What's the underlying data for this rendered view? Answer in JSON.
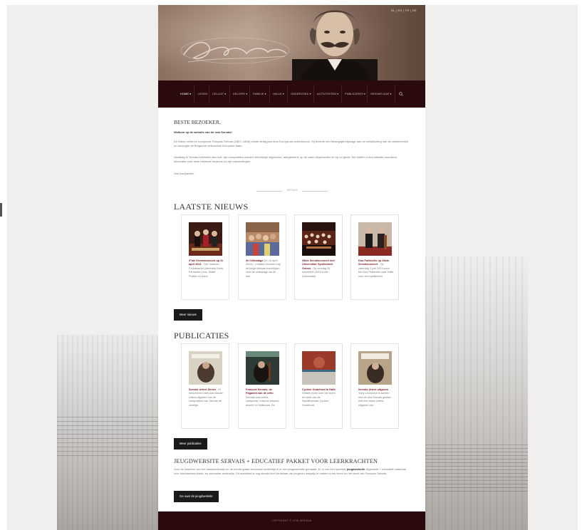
{
  "header": {
    "language_links": "NL  |  EN  |  FR  |  DE"
  },
  "nav": {
    "items": [
      {
        "label": "HOME ▾",
        "active": true
      },
      {
        "label": "LEVEN"
      },
      {
        "label": "CELLIST ▾"
      },
      {
        "label": "DELIVRE ▾"
      },
      {
        "label": "FAMILIE ▾"
      },
      {
        "label": "HALLE ▾"
      },
      {
        "label": "ONDERZOEK ▾"
      },
      {
        "label": "ACTIVITEITEN ▾"
      },
      {
        "label": "PUBLICATIES ▾"
      },
      {
        "label": "SERVAIS AGE ▾"
      }
    ],
    "search_icon": "search-icon"
  },
  "welcome": {
    "heading": "BESTE BEZOEKER,",
    "lead": "Welkom op de website van de vzw Servais!",
    "p1": "De Halse cellist en componist François Servais (1807–1866) reisde dertig jaar door Europa als cellovirtuoos. Hij leverde een belangrijke bijdrage aan de ontwikkeling van de cellotechniek en bezorgde de Belgische celloschool Europese faam.",
    "p2": "Vandaag is Servais bekender dan ooit: zijn composities worden wereldwijd uitgevoerd, aangekeerd, op de radio uitgezonden en op cd gezet. We bieden u een website boordevol informatie over deze bekende muzicus en zijn nakomelingen.",
    "p3": "Veel surfplezier!",
    "divider_text": "SERVAIS"
  },
  "news": {
    "title": "LAATSTE NIEUWS",
    "items": [
      {
        "title": "3°ste Servaisconcert op 11 april 2024",
        "text": " - Het Tarantan Cellokwartet (Mechiels Dolin, Fernando Lima, Didier Poskin en Karel"
      },
      {
        "title": "3e Cellostage",
        "text": " (11-14 april 2024) - Cellisten kunnen nog tot begin februari inschrijven voor de cellostage via de site."
      },
      {
        "title": "35ste Servaisconcert met Universitair Symfonisch Orkest",
        "text": " - Op zondag 26 november 2023 is het Universitair"
      },
      {
        "title": "Duo Potteceilo op 26ste Servaisconcert",
        "text": " - Op zaterdag 3 juni 2023 komt het Duo Potteceilo naar Halle voor een spetterend"
      }
    ],
    "button": "Meer nieuws"
  },
  "publications": {
    "title": "PUBLICATIES",
    "items": [
      {
        "title": "Servais Urtext Series",
        "text": " - Er verschenen heel wat nieuwe Urtext-uitgaven van de composities van Servais de voorbije"
      },
      {
        "title": "François Servais, de Paganini van de cello",
        "text": " - Servais was cellist, componist, reizend virtuoos, docent en Hallenaar. De"
      },
      {
        "title": "Cyclien Godefroid in Halle",
        "text": " - Ontdek meer over het leven en werk van de Ssedifroenaar Cyclien Godefroid."
      },
      {
        "title": "Servais Urtext uitgaven",
        "text": " - Yuny Leonovich is samen met de vzw Servais gestart met een reeks Urtext-uitgaven van"
      }
    ],
    "button": "Meer publicaties"
  },
  "youth": {
    "title": "JEUGDWEBSITE SERVAIS + EDUCATIEF PAKKET VOOR LEERKRACHTEN",
    "text_before": "Voor de kinderen van het basisonderwijs en de eerste graad secundair onderwijs is er een jeugdwebsite gemaakt. Er is ook een speciale ",
    "text_bold": "jeugdwebsite",
    "text_after": " uitgewerkt + educatief materiaal voor leerkrachten basis- en secundair onderwijs. Dit materiaal is nog steeds heel bruikbaar om jongeren wegwijs te maken in het leven en het werk van François Servais.",
    "button": "Ga naar de jeugdwebsite"
  },
  "footer": {
    "copyright": "COPYRIGHT © VZW SERVAIS"
  },
  "colors": {
    "nav_bg": "#2a0a0d",
    "accent": "#7a1a22",
    "button_bg": "#1a1a1a"
  }
}
